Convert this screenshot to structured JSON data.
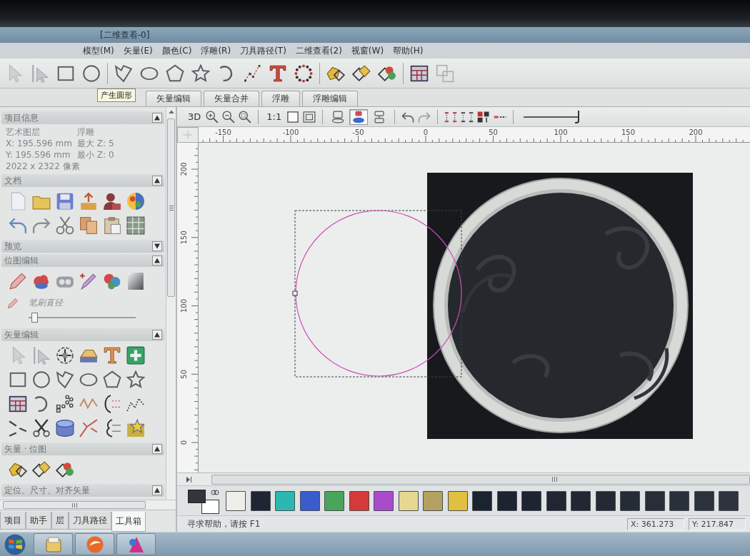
{
  "window": {
    "title": "[二维查看-0]"
  },
  "menu": [
    "模型(M)",
    "矢量(E)",
    "颜色(C)",
    "浮雕(R)",
    "刀具路径(T)",
    "二维查看(2)",
    "视窗(W)",
    "帮助(H)"
  ],
  "toolbar": {
    "tooltip": "产生圆形"
  },
  "tabs": [
    {
      "label": "矢量编辑",
      "selected": false
    },
    {
      "label": "矢量合并",
      "selected": false
    },
    {
      "label": "浮雕",
      "selected": false
    },
    {
      "label": "浮雕编辑",
      "selected": false
    }
  ],
  "side_panel": {
    "sections": [
      {
        "kind": "info",
        "title": "项目信息",
        "expanded": true,
        "rows": [
          {
            "label": "艺术图层",
            "value": "浮雕"
          },
          {
            "label": "X: 195.596 mm",
            "value": "最大 Z: 5"
          },
          {
            "label": "Y: 195.596 mm",
            "value": "最小 Z: 0"
          },
          {
            "label": "2022 x 2322 像素"
          }
        ]
      },
      {
        "kind": "document",
        "title": "文档",
        "expanded": true
      },
      {
        "title": "预览",
        "expanded": false
      },
      {
        "kind": "bitmap",
        "title": "位图编辑",
        "expanded": true,
        "brush": {
          "label": "笔刷直径",
          "level": 0.03
        }
      },
      {
        "kind": "vector",
        "title": "矢量编辑",
        "expanded": true
      },
      {
        "kind": "vector_bitmap",
        "title": "矢量 · 位图",
        "expanded": true
      },
      {
        "title": "定位、尺寸、对齐矢量",
        "expanded": true
      }
    ],
    "tabs": [
      {
        "label": "项目",
        "selected": false
      },
      {
        "label": "助手",
        "selected": false
      },
      {
        "label": "层",
        "selected": false
      },
      {
        "label": "刀具路径",
        "selected": false
      },
      {
        "label": "工具箱",
        "selected": true
      }
    ]
  },
  "view_toolbar": {
    "view_3d": "3D",
    "actual_size": "1:1",
    "modes": [
      {
        "selected": false
      },
      {
        "selected": true
      },
      {
        "selected": false
      }
    ],
    "zoom_slider": {
      "level": 1
    }
  },
  "rulers": {
    "x_labels": [
      "-150",
      "-100",
      "-50",
      "0",
      "50",
      "100",
      "150",
      "200"
    ],
    "y_labels": [
      "200",
      "150",
      "100",
      "50",
      "0"
    ]
  },
  "palette": {
    "current_colors": [
      {
        "color": "#34343e"
      },
      {
        "color": "#ffffff"
      }
    ],
    "swatches": [
      {
        "color": "#efefea"
      },
      {
        "color": "#1e2633"
      },
      {
        "color": "#2ab8b0"
      },
      {
        "color": "#3a5ccc"
      },
      {
        "color": "#4aa45a"
      },
      {
        "color": "#d43a3a"
      },
      {
        "color": "#a84ccc"
      },
      {
        "color": "#e6d890"
      },
      {
        "color": "#b4a060"
      },
      {
        "color": "#e0c040"
      },
      {
        "color": "#1c2330"
      },
      {
        "color": "#1d2431"
      },
      {
        "color": "#1e2532"
      },
      {
        "color": "#202633"
      },
      {
        "color": "#212834"
      },
      {
        "color": "#232a36"
      },
      {
        "color": "#252b37"
      },
      {
        "color": "#272d39"
      },
      {
        "color": "#292f3b"
      },
      {
        "color": "#2b313d"
      },
      {
        "color": "#2e333f"
      }
    ]
  },
  "status_bar": {
    "help": "寻求帮助，请按 F1",
    "x": "X: 361.273",
    "y": "Y: 217.847"
  }
}
